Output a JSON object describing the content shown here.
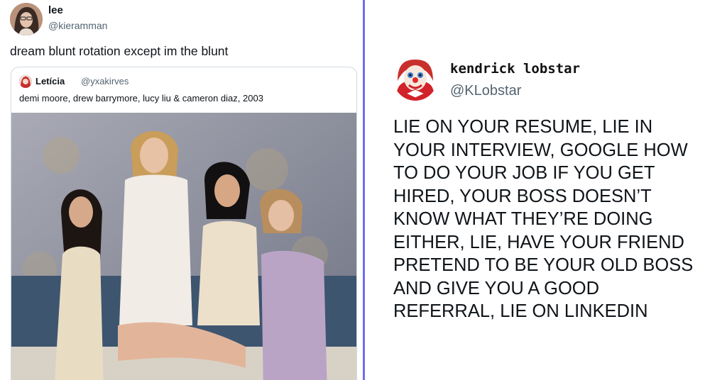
{
  "left_tweet": {
    "name": "lee",
    "handle": "@kieramman",
    "text": "dream blunt rotation except im the blunt",
    "avatar_icon": "user-avatar-icon",
    "quote": {
      "name": "Letícia",
      "handle": "@yxakirves",
      "text": "demi moore, drew barrymore, lucy liu & cameron diaz, 2003",
      "avatar_icon": "user-avatar-icon"
    }
  },
  "right_tweet": {
    "name": "kendrick lobstar",
    "handle": "@KLobstar",
    "avatar_icon": "clown-avatar-icon",
    "text_lines": [
      "LIE ON YOUR RESUME, LIE IN",
      "YOUR INTERVIEW, GOOGLE HOW",
      "TO DO YOUR JOB IF YOU GET",
      "HIRED, YOUR BOSS DOESN’T",
      "KNOW WHAT THEY’RE DOING",
      "EITHER, LIE, HAVE YOUR FRIEND",
      "PRETEND TO BE YOUR OLD BOSS",
      "AND GIVE YOU A GOOD",
      "REFERRAL, LIE ON LINKEDIN"
    ]
  },
  "colors": {
    "divider": "#6f6df0",
    "text_primary": "#0f1419",
    "text_secondary": "#536471",
    "card_border": "#cfd9de"
  }
}
